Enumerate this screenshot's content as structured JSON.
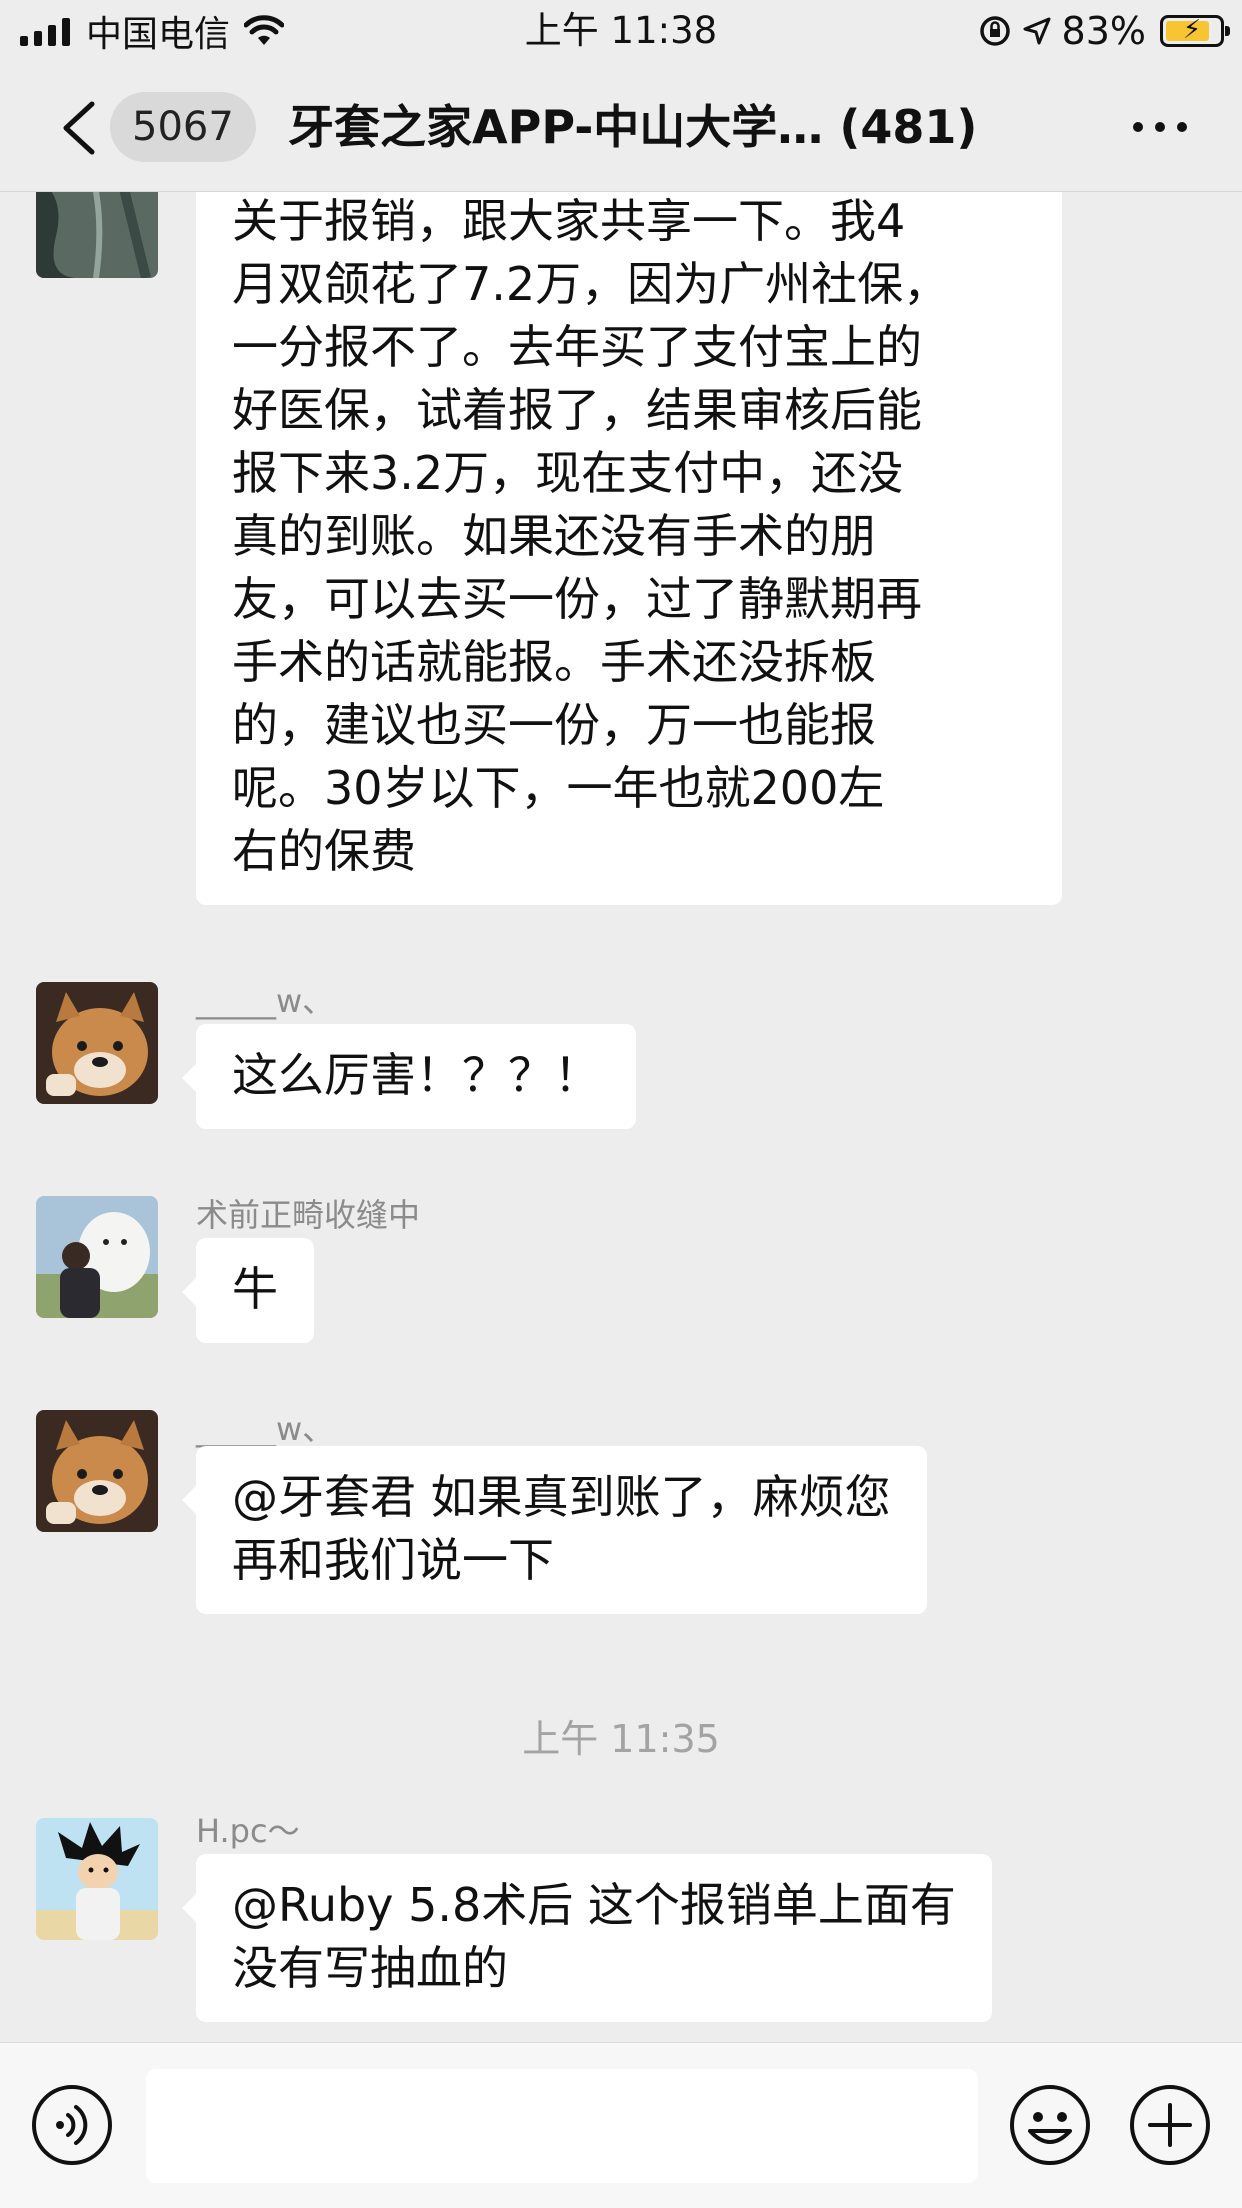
{
  "status_bar": {
    "carrier": "中国电信",
    "time": "上午 11:38",
    "battery": "83%",
    "battery_level": 0.83
  },
  "nav": {
    "unread_count": "5067",
    "title": "牙套之家APP-中山大学…  (481)"
  },
  "messages": [
    {
      "sender": "",
      "text_lines": [
        "关于报销，跟大家共享一下。我4",
        "月双颌花了7.2万，因为广州社保，",
        "一分报不了。去年买了支付宝上的",
        "好医保，试着报了，结果审核后能",
        "报下来3.2万，现在支付中，还没",
        "真的到账。如果还没有手术的朋",
        "友，可以去买一份，过了静默期再",
        "手术的话就能报。手术还没拆板",
        "的，建议也买一份，万一也能报",
        "呢。30岁以下，一年也就200左",
        "右的保费"
      ]
    },
    {
      "sender": "_____w、",
      "text_lines": [
        "这么厉害！？？！"
      ]
    },
    {
      "sender": "术前正畸收缝中",
      "text_lines": [
        "牛"
      ]
    },
    {
      "sender": "_____w、",
      "text_lines": [
        "@牙套君 如果真到账了，麻烦您",
        "再和我们说一下"
      ]
    },
    {
      "time_divider": "上午 11:35"
    },
    {
      "sender": "H.pc～",
      "text_lines": [
        "@Ruby 5.8术后 这个报销单上面有",
        "没有写抽血的"
      ]
    }
  ],
  "input_bar": {
    "placeholder": ""
  },
  "icons": {
    "back": "chevron-left-icon",
    "more": "more-dots-icon",
    "voice": "voice-icon",
    "emoji": "emoji-icon",
    "plus": "plus-icon"
  },
  "colors": {
    "background": "#ededed",
    "bubble": "#ffffff",
    "battery": "#f6c531"
  }
}
